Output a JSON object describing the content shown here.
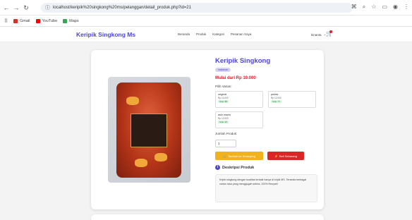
{
  "browser": {
    "url": "localhost/keripik%20singkong%20ms/pelanggan/detail_produk.php?id=21",
    "bookmarks": [
      {
        "label": "Gmail",
        "color": "#d93025"
      },
      {
        "label": "YouTube",
        "color": "#ff0000"
      },
      {
        "label": "Maps",
        "color": "#34a853"
      }
    ]
  },
  "header": {
    "brand": "Keripik Singkong Ms",
    "menu": [
      "Beranda",
      "Produk",
      "Kategori",
      "Pesanan Saya"
    ],
    "user": "kinanta"
  },
  "product": {
    "title": "Keripik Singkong",
    "category": "makanan",
    "price": "Mulai dari Rp 10.000",
    "variant_label": "Pilih Varian:",
    "variants": [
      {
        "name": "original",
        "price": "Rp 10.000",
        "stock": "Stok: 88"
      },
      {
        "name": "pedas",
        "price": "Rp 12.000",
        "stock": "Stok: 77"
      },
      {
        "name": "asin manis",
        "price": "Rp 12.000",
        "stock": "Stok: 20"
      }
    ],
    "qty_label": "Jumlah Produk:",
    "qty_value": "1",
    "add_to_cart": "Tambah ke Keranjang",
    "buy_now": "Beli Sekarang",
    "desc_heading": "Deskripsi Produk",
    "description": "Kripik singkong dengan kualitas terbaik hanya di kripik MS. Tersedia berbagai varian rasa yang menggugah selera. 100% Renyah!"
  }
}
